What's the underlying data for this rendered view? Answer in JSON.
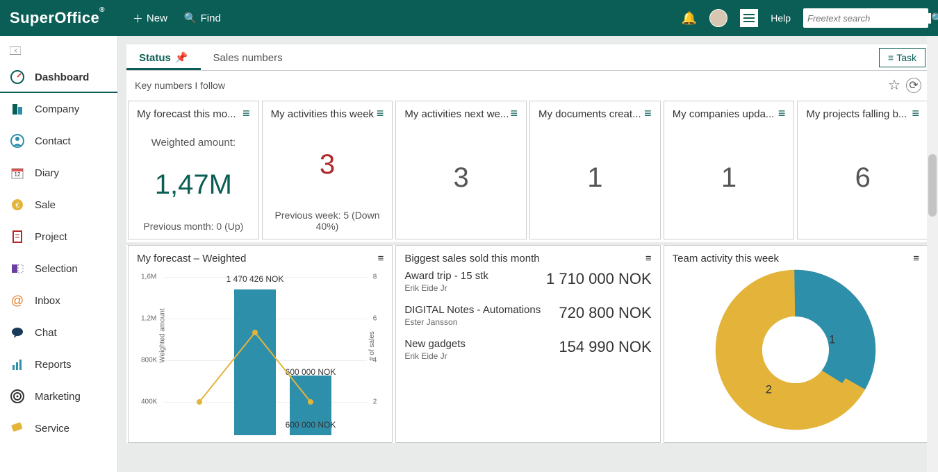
{
  "brand": "SuperOffice",
  "top": {
    "new": "New",
    "find": "Find",
    "help": "Help",
    "search_placeholder": "Freetext search"
  },
  "sidebar": {
    "items": [
      {
        "label": "Dashboard",
        "active": true
      },
      {
        "label": "Company"
      },
      {
        "label": "Contact"
      },
      {
        "label": "Diary"
      },
      {
        "label": "Sale"
      },
      {
        "label": "Project"
      },
      {
        "label": "Selection"
      },
      {
        "label": "Inbox"
      },
      {
        "label": "Chat"
      },
      {
        "label": "Reports"
      },
      {
        "label": "Marketing"
      },
      {
        "label": "Service"
      }
    ]
  },
  "tabs": {
    "status": "Status",
    "sales": "Sales numbers",
    "task": "Task"
  },
  "subtitle": "Key numbers I follow",
  "cards": [
    {
      "title": "My forecast this mo...",
      "sub1": "Weighted amount:",
      "value": "1,47M",
      "sub2": "Previous month: 0 (Up)",
      "style": "green"
    },
    {
      "title": "My activities this week",
      "value": "3",
      "sub2": "Previous week: 5 (Down 40%)",
      "style": "red"
    },
    {
      "title": "My activities next we...",
      "value": "3"
    },
    {
      "title": "My documents creat...",
      "value": "1"
    },
    {
      "title": "My companies upda...",
      "value": "1"
    },
    {
      "title": "My projects falling b...",
      "value": "6"
    }
  ],
  "forecast_panel": {
    "title": "My forecast – Weighted"
  },
  "sales_panel": {
    "title": "Biggest sales sold this month",
    "items": [
      {
        "name": "Award trip - 15 stk",
        "owner": "Erik Eide Jr",
        "amount": "1 710 000 NOK"
      },
      {
        "name": "DIGITAL Notes - Automations",
        "owner": "Ester Jansson",
        "amount": "720 800 NOK"
      },
      {
        "name": "New gadgets",
        "owner": "Erik Eide Jr",
        "amount": "154 990 NOK"
      }
    ]
  },
  "team_panel": {
    "title": "Team activity this week"
  },
  "chart_data": [
    {
      "type": "bar",
      "title": "My forecast – Weighted",
      "ylabel": "Weighted amount",
      "y2label": "# of sales",
      "yticks": [
        "400K",
        "800K",
        "1,2M",
        "1,6M"
      ],
      "y2ticks": [
        "2",
        "4",
        "6",
        "8"
      ],
      "bars": [
        {
          "label": "1 470 426 NOK",
          "value": 1470426
        },
        {
          "label": "600 000 NOK",
          "value": 600000
        },
        {
          "label": "600 000 NOK",
          "value": 600000
        }
      ],
      "line_values": [
        400000,
        1100000,
        400000
      ],
      "ylim": [
        0,
        1600000
      ]
    },
    {
      "type": "pie",
      "title": "Team activity this week",
      "series": [
        {
          "name": "1",
          "value": 1,
          "color": "#2e8fab"
        },
        {
          "name": "2",
          "value": 2,
          "color": "#e4b43a"
        }
      ]
    }
  ]
}
